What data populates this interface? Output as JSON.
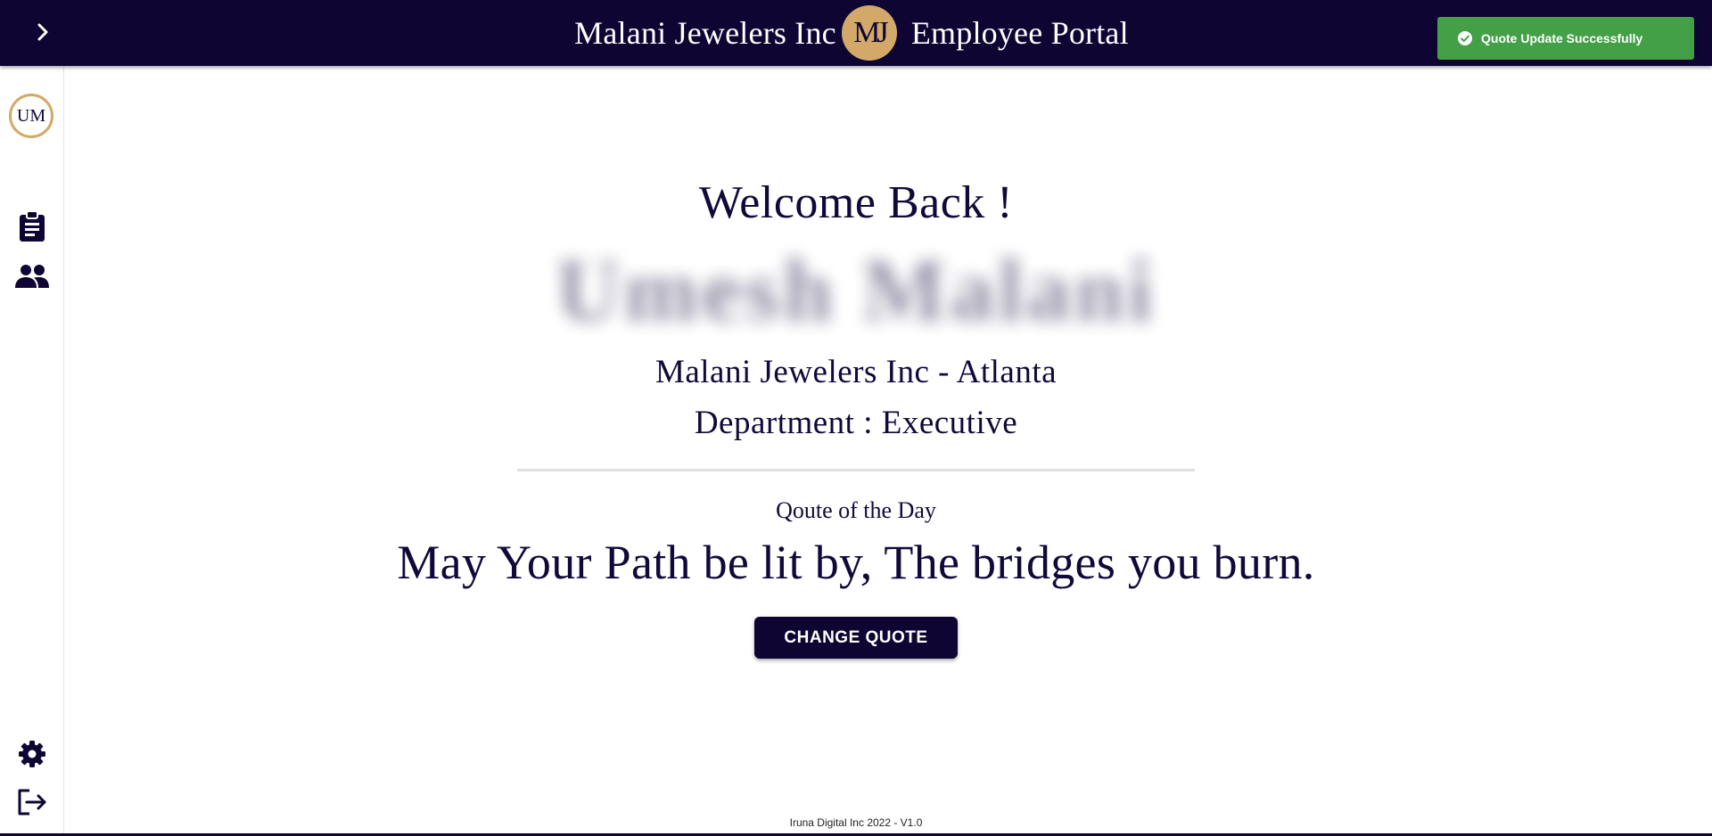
{
  "header": {
    "company": "Malani Jewelers Inc",
    "logo_text": "MJ",
    "portal": "Employee Portal",
    "menu_icon": "chevron-right-icon"
  },
  "toast": {
    "message": "Quote Update Successfully",
    "icon": "check-circle-icon",
    "color": "#43a047"
  },
  "sidebar": {
    "avatar_initials": "UM",
    "items": [
      {
        "icon": "clipboard-icon"
      },
      {
        "icon": "people-icon"
      }
    ],
    "bottom_items": [
      {
        "icon": "gear-icon"
      },
      {
        "icon": "logout-icon"
      }
    ]
  },
  "main": {
    "welcome": "Welcome Back !",
    "user_name": "Umesh Malani",
    "company_location": "Malani Jewelers Inc - Atlanta",
    "department": "Department : Executive",
    "quote_label": "Qoute of the Day",
    "quote": "May Your Path be lit by, The bridges you burn.",
    "change_button": "CHANGE QUOTE"
  },
  "footer": {
    "text": "Iruna Digital Inc 2022 - V1.0"
  },
  "colors": {
    "primary": "#0e0533",
    "accent_gold": "#d2a968",
    "success": "#43a047"
  }
}
